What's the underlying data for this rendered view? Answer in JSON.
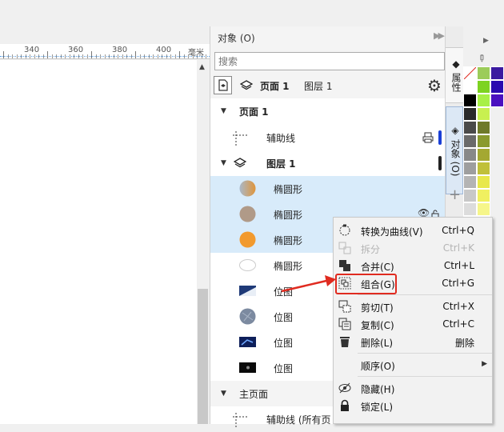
{
  "ruler": {
    "ticks": [
      "340",
      "360",
      "380",
      "400"
    ],
    "unit": "毫米"
  },
  "panel": {
    "title": "对象 (O)",
    "search_placeholder": "搜索",
    "page_label": "页面 1",
    "layer_label": "图层 1"
  },
  "tree": {
    "page": "页面 1",
    "guides": "辅助线",
    "layer": "图层 1",
    "items": [
      {
        "label": "椭圆形",
        "thumb": "gradient-ellipse"
      },
      {
        "label": "椭圆形",
        "thumb": "tan-ellipse"
      },
      {
        "label": "椭圆形",
        "thumb": "orange-ellipse"
      },
      {
        "label": "椭圆形",
        "thumb": "white-ellipse"
      },
      {
        "label": "位图",
        "thumb": "bitmap-blue-white"
      },
      {
        "label": "位图",
        "thumb": "bitmap-gray-round"
      },
      {
        "label": "位图",
        "thumb": "bitmap-blue-dark"
      },
      {
        "label": "位图",
        "thumb": "bitmap-black"
      }
    ],
    "master_page": "主页面",
    "master_guides": "辅助线 (所有页"
  },
  "side_tabs": {
    "properties": "属性",
    "objects": "对象 (O)"
  },
  "context_menu": {
    "items": [
      {
        "label": "转换为曲线(V)",
        "shortcut": "Ctrl+Q",
        "icon": "convert-curve-icon",
        "disabled": false
      },
      {
        "label": "拆分",
        "shortcut": "Ctrl+K",
        "icon": "break-apart-icon",
        "disabled": true
      },
      {
        "label": "合并(C)",
        "shortcut": "Ctrl+L",
        "icon": "combine-icon",
        "disabled": false
      },
      {
        "label": "组合(G)",
        "shortcut": "Ctrl+G",
        "icon": "group-icon",
        "disabled": false
      },
      {
        "label": "剪切(T)",
        "shortcut": "Ctrl+X",
        "icon": "cut-icon",
        "disabled": false
      },
      {
        "label": "复制(C)",
        "shortcut": "Ctrl+C",
        "icon": "copy-icon",
        "disabled": false
      },
      {
        "label": "删除(L)",
        "shortcut": "删除",
        "icon": "delete-icon",
        "disabled": false
      },
      {
        "label": "顺序(O)",
        "shortcut": "",
        "icon": "",
        "disabled": false
      },
      {
        "label": "隐藏(H)",
        "shortcut": "",
        "icon": "hide-icon",
        "disabled": false
      },
      {
        "label": "锁定(L)",
        "shortcut": "",
        "icon": "lock-icon",
        "disabled": false
      }
    ]
  },
  "colors": {
    "highlight": "#e02b20",
    "selection": "#d8ebfa",
    "accent_bar": "#1a3fd6"
  }
}
